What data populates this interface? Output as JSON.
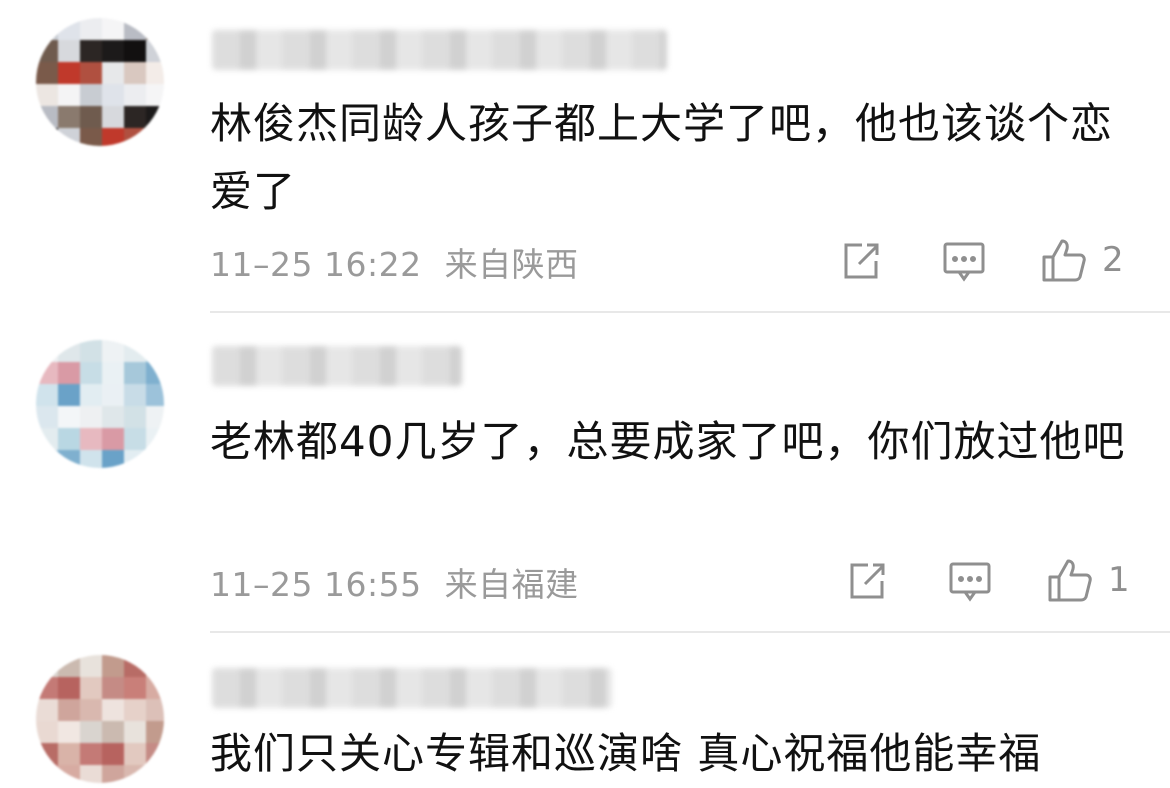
{
  "comments": [
    {
      "text": "林俊杰同龄人孩子都上大学了吧，他也该谈个恋爱了",
      "time": "11–25 16:22",
      "location": "来自陕西",
      "likes": "2",
      "avatar_colors": [
        "#c8ccd2",
        "#dfe3ea",
        "#ecedf0",
        "#f5f5f6",
        "#b9bcc4",
        "#8a7a6e",
        "#6f5b4e",
        "#d7d9dd",
        "#2c2624",
        "#1c1a1a",
        "#121010",
        "#cfd2d8",
        "#7a5a4a",
        "#c0392b",
        "#b05040",
        "#e7e8ea",
        "#d9c8c0",
        "#f3ece8",
        "#ece6e2",
        "#f4f4f5"
      ]
    },
    {
      "text": "老林都40几岁了，总要成家了吧，你们放过他吧",
      "time": "11–25 16:55",
      "location": "来自福建",
      "likes": "1",
      "avatar_colors": [
        "#eef0f2",
        "#dfe7ea",
        "#d2e1e6",
        "#eef2f4",
        "#e3ecef",
        "#b9d7e3",
        "#e7b9c0",
        "#d99aa5",
        "#c7dde6",
        "#eaf1f4",
        "#a6c8da",
        "#7fb0cf",
        "#d0e3ec",
        "#6aa2c8",
        "#e2edf2",
        "#eaf0f4",
        "#c8dce7",
        "#9cc2da",
        "#dbe7ee",
        "#f3f6f8"
      ]
    },
    {
      "text": "我们只关心专辑和巡演啥 真心祝福他能幸福",
      "avatar_colors": [
        "#d9d4cf",
        "#cbbab0",
        "#e8e2dc",
        "#c29b8d",
        "#b86c66",
        "#d9b3a8",
        "#c47a76",
        "#b7635f",
        "#e2c9c0",
        "#c58b85",
        "#c97f79",
        "#d7aba2",
        "#eadcd6",
        "#cfa59c",
        "#d9b8af",
        "#eee3de",
        "#e6d1c9",
        "#dcc0b8",
        "#e9d9d2",
        "#f1e7e2"
      ]
    }
  ]
}
